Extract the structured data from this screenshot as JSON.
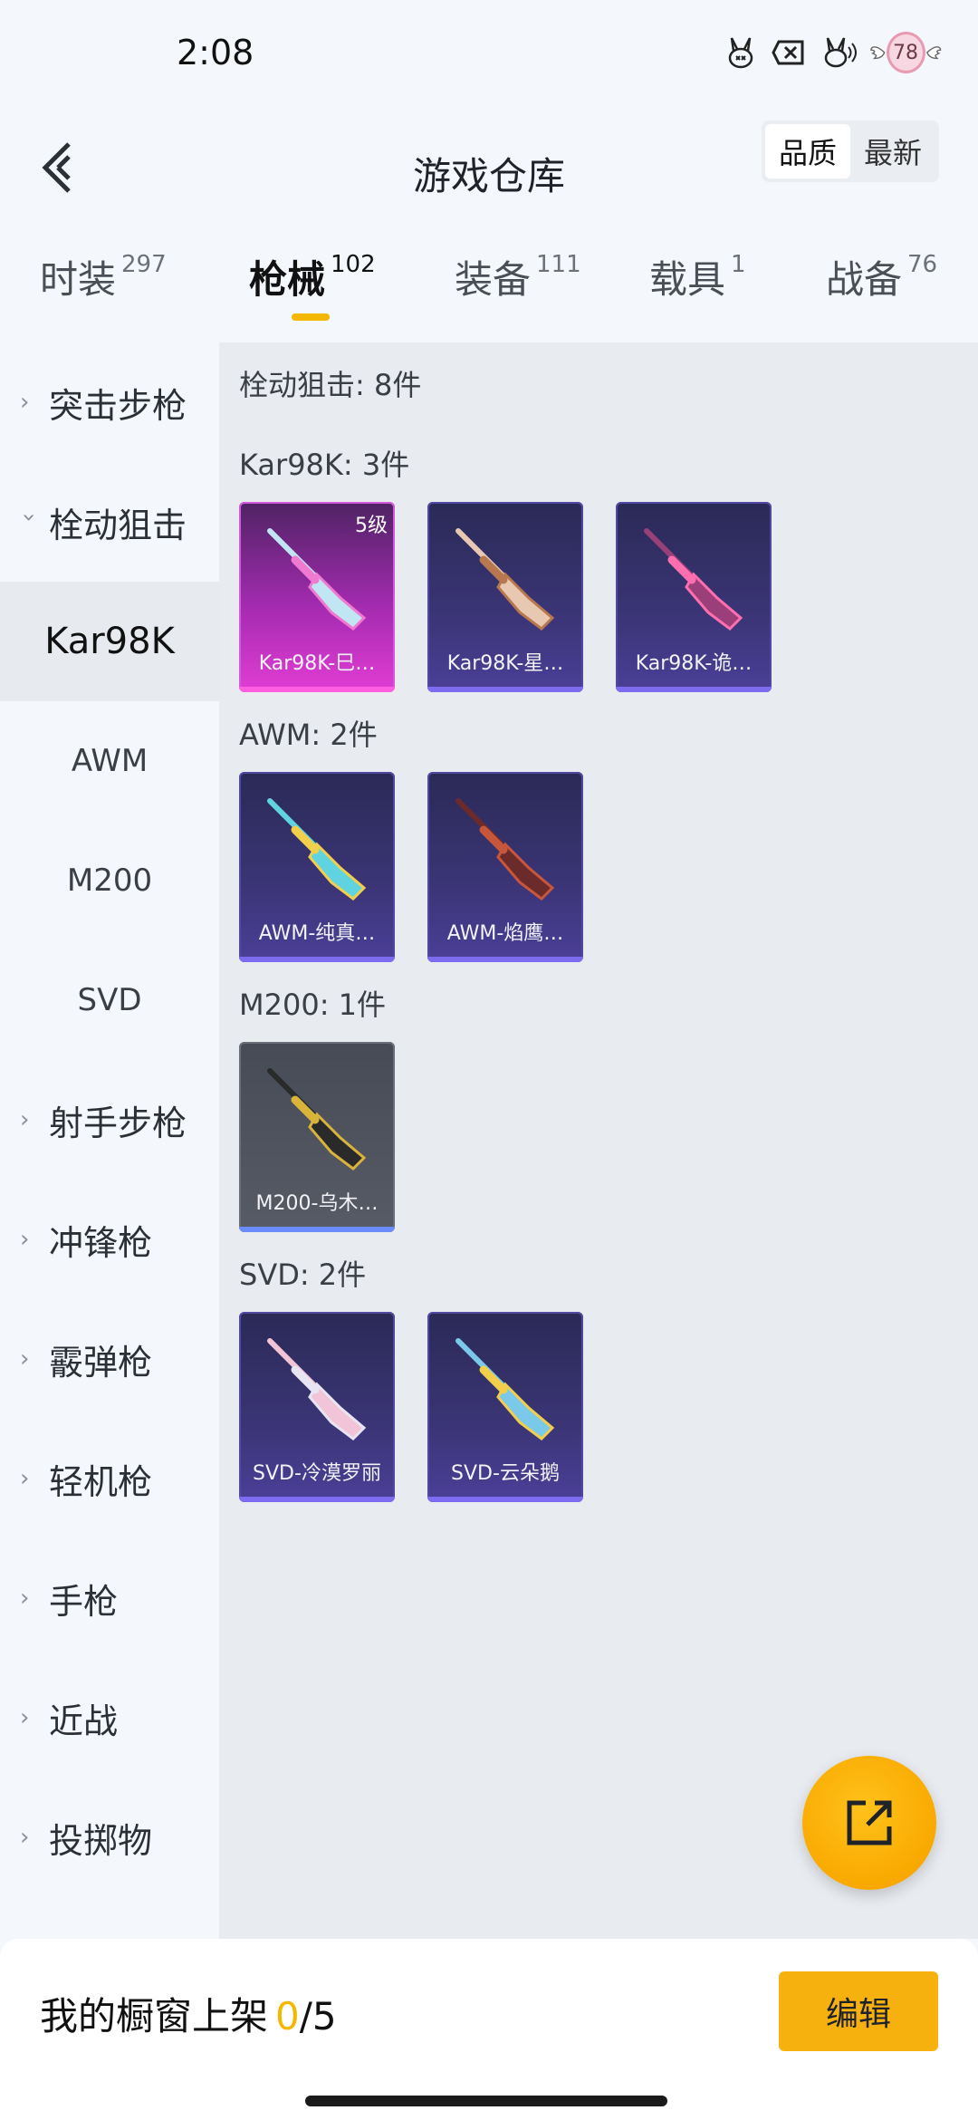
{
  "status": {
    "time": "2:08",
    "badge": "78",
    "icons": [
      "bunny-sticker-icon",
      "close-box-icon",
      "bunny-signal-icon",
      "winged-badge-icon"
    ]
  },
  "nav": {
    "title": "游戏仓库",
    "sort": {
      "quality": "品质",
      "latest": "最新",
      "active": "quality"
    }
  },
  "tabs": [
    {
      "label": "时装",
      "count": "297"
    },
    {
      "label": "枪械",
      "count": "102",
      "active": true
    },
    {
      "label": "装备",
      "count": "111"
    },
    {
      "label": "载具",
      "count": "1"
    },
    {
      "label": "战备",
      "count": "76"
    }
  ],
  "sidebar": {
    "items": [
      {
        "label": "突击步枪",
        "type": "category",
        "expanded": false
      },
      {
        "label": "栓动狙击",
        "type": "category",
        "expanded": true
      },
      {
        "label": "Kar98K",
        "type": "sub",
        "selected": true
      },
      {
        "label": "AWM",
        "type": "sub"
      },
      {
        "label": "M200",
        "type": "sub"
      },
      {
        "label": "SVD",
        "type": "sub"
      },
      {
        "label": "射手步枪",
        "type": "category",
        "expanded": false
      },
      {
        "label": "冲锋枪",
        "type": "category",
        "expanded": false
      },
      {
        "label": "霰弹枪",
        "type": "category",
        "expanded": false
      },
      {
        "label": "轻机枪",
        "type": "category",
        "expanded": false
      },
      {
        "label": "手枪",
        "type": "category",
        "expanded": false
      },
      {
        "label": "近战",
        "type": "category",
        "expanded": false
      },
      {
        "label": "投掷物",
        "type": "category",
        "expanded": false
      }
    ]
  },
  "content": {
    "summary": "栓动狙击: 8件",
    "sections": [
      {
        "title": "Kar98K: 3件",
        "items": [
          {
            "name": "Kar98K-巳…",
            "level": "5级",
            "rarity": "pink",
            "gun_color": "#bfe6f2",
            "accent": "#f07ad0"
          },
          {
            "name": "Kar98K-星…",
            "rarity": "purple",
            "gun_color": "#e8c8b0",
            "accent": "#b7774f"
          },
          {
            "name": "Kar98K-诡…",
            "rarity": "purple",
            "gun_color": "#9b3f7a",
            "accent": "#ff6fb0"
          }
        ]
      },
      {
        "title": "AWM: 2件",
        "items": [
          {
            "name": "AWM-纯真…",
            "rarity": "purple",
            "gun_color": "#5fd4e0",
            "accent": "#f2cf4a"
          },
          {
            "name": "AWM-焰鹰…",
            "rarity": "purple",
            "gun_color": "#6b2b2b",
            "accent": "#c7563b"
          }
        ]
      },
      {
        "title": "M200: 1件",
        "items": [
          {
            "name": "M200-乌木…",
            "rarity": "gray",
            "gun_color": "#2a2a2a",
            "accent": "#d8b43a"
          }
        ]
      },
      {
        "title": "SVD: 2件",
        "items": [
          {
            "name": "SVD-冷漠罗丽",
            "rarity": "purple",
            "gun_color": "#f2c4d8",
            "accent": "#e9e4f1"
          },
          {
            "name": "SVD-云朵鹅",
            "rarity": "purple",
            "gun_color": "#7ac8ea",
            "accent": "#f2cf4a"
          }
        ]
      }
    ]
  },
  "fab": {
    "icon": "share-external-icon"
  },
  "footer": {
    "label": "我的橱窗上架",
    "current": "0",
    "sep": "/",
    "max": "5",
    "edit_label": "编辑"
  },
  "colors": {
    "accent": "#f5b800",
    "edit_button": "#f7b10e",
    "fab": "#f9a900"
  }
}
